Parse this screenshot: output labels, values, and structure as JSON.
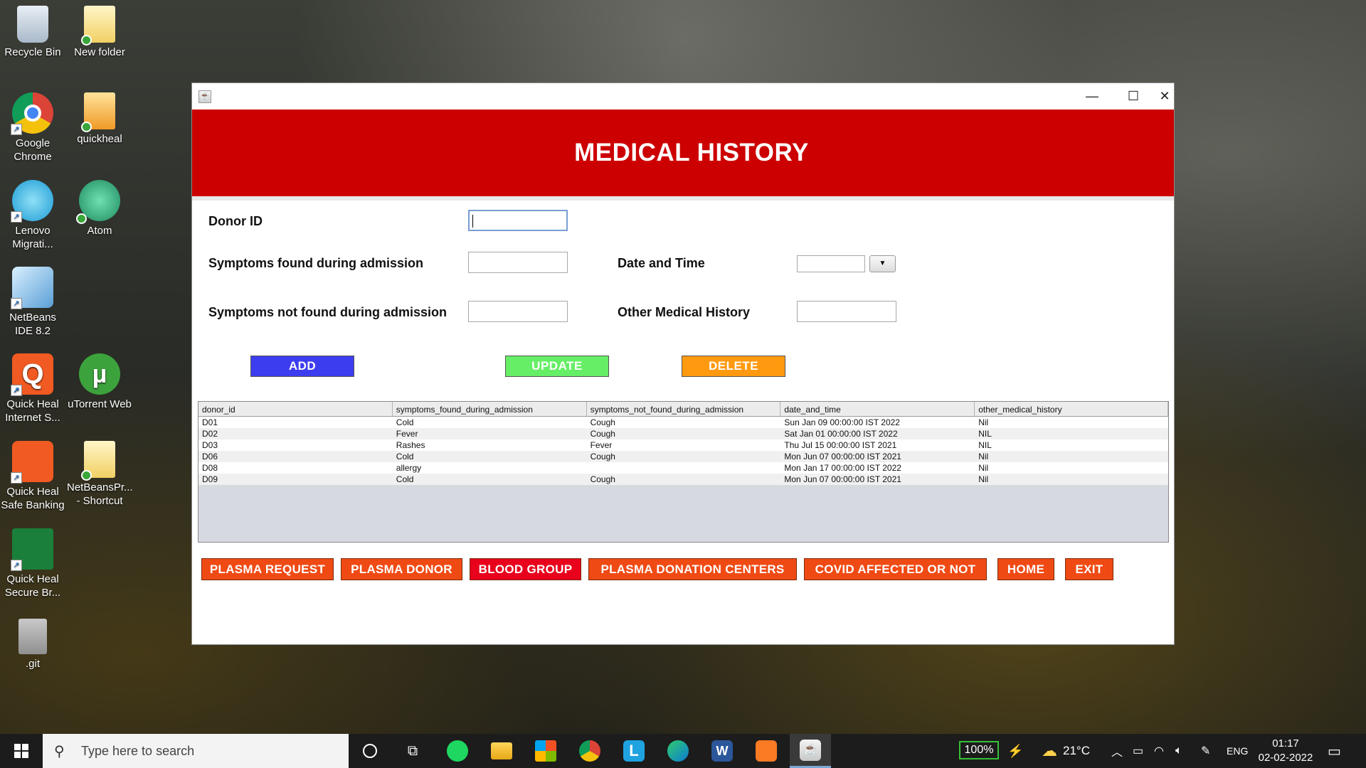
{
  "desktop": {
    "icons": [
      {
        "label": "Recycle Bin",
        "icon": "recycle-bin-icon"
      },
      {
        "label": "New folder",
        "icon": "folder-icon"
      },
      {
        "label": "Google Chrome",
        "icon": "chrome-icon"
      },
      {
        "label": "quickheal",
        "icon": "quickheal-folder-icon"
      },
      {
        "label": "Lenovo Migrati...",
        "icon": "lenovo-migration-icon"
      },
      {
        "label": "Atom",
        "icon": "atom-icon"
      },
      {
        "label": "NetBeans IDE 8.2",
        "icon": "netbeans-icon"
      },
      {
        "label": "Quick Heal Internet S...",
        "icon": "quickheal-internet-security-icon"
      },
      {
        "label": "uTorrent Web",
        "icon": "utorrent-icon"
      },
      {
        "label": "Quick Heal Safe Banking",
        "icon": "quickheal-safe-banking-icon"
      },
      {
        "label": "NetBeansPr... - Shortcut",
        "icon": "folder-shortcut-icon"
      },
      {
        "label": "Quick Heal Secure Br...",
        "icon": "quickheal-secure-browser-icon"
      },
      {
        "label": ".git",
        "icon": "git-folder-icon"
      }
    ]
  },
  "window": {
    "title": "",
    "controls": {
      "minimize": "—",
      "maximize": "☐",
      "close": "✕"
    },
    "header": "MEDICAL HISTORY",
    "colors": {
      "header": "#cc0000",
      "add": "#3d3df0",
      "update": "#66ee66",
      "delete": "#ff9a10",
      "nav": "#f04a14",
      "nav_alt": "#e8001c"
    },
    "form": {
      "donor_id_label": "Donor ID",
      "donor_id_value": "",
      "symptoms_found_label": "Symptoms found during admission",
      "symptoms_found_value": "",
      "symptoms_not_found_label": "Symptoms not found during admission",
      "symptoms_not_found_value": "",
      "date_time_label": "Date and Time",
      "date_time_value": "",
      "other_history_label": "Other Medical History",
      "other_history_value": ""
    },
    "buttons": {
      "add": "ADD",
      "update": "UPDATE",
      "delete": "DELETE"
    },
    "table": {
      "columns": [
        "donor_id",
        "symptoms_found_during_admission",
        "symptoms_not_found_during_admission",
        "date_and_time",
        "other_medical_history"
      ],
      "rows": [
        [
          "D01",
          "Cold",
          "Cough",
          "Sun Jan 09 00:00:00 IST 2022",
          "Nil"
        ],
        [
          "D02",
          "Fever",
          "Cough",
          "Sat Jan 01 00:00:00 IST 2022",
          "NIL"
        ],
        [
          "D03",
          "Rashes",
          "Fever",
          "Thu Jul 15 00:00:00 IST 2021",
          "NIL"
        ],
        [
          "D06",
          "Cold",
          "Cough",
          "Mon Jun 07 00:00:00 IST 2021",
          "Nil"
        ],
        [
          "D08",
          "allergy",
          "",
          "Mon Jan 17 00:00:00 IST 2022",
          "Nil"
        ],
        [
          "D09",
          "Cold",
          "Cough",
          "Mon Jun 07 00:00:00 IST 2021",
          "Nil"
        ]
      ]
    },
    "nav": [
      "PLASMA REQUEST",
      "PLASMA DONOR",
      "BLOOD GROUP",
      "PLASMA DONATION CENTERS",
      "COVID AFFECTED OR NOT",
      "HOME",
      "EXIT"
    ]
  },
  "taskbar": {
    "search_placeholder": "Type here to search",
    "apps": [
      "cortana-icon",
      "task-view-icon",
      "spotify-icon",
      "file-explorer-icon",
      "microsoft-store-icon",
      "chrome-icon",
      "lenovo-l-icon",
      "edge-icon",
      "word-icon",
      "xampp-icon",
      "java-app-icon"
    ],
    "battery": "100%",
    "temperature": "21°C",
    "language": "ENG",
    "time": "01:17",
    "date": "02-02-2022"
  }
}
